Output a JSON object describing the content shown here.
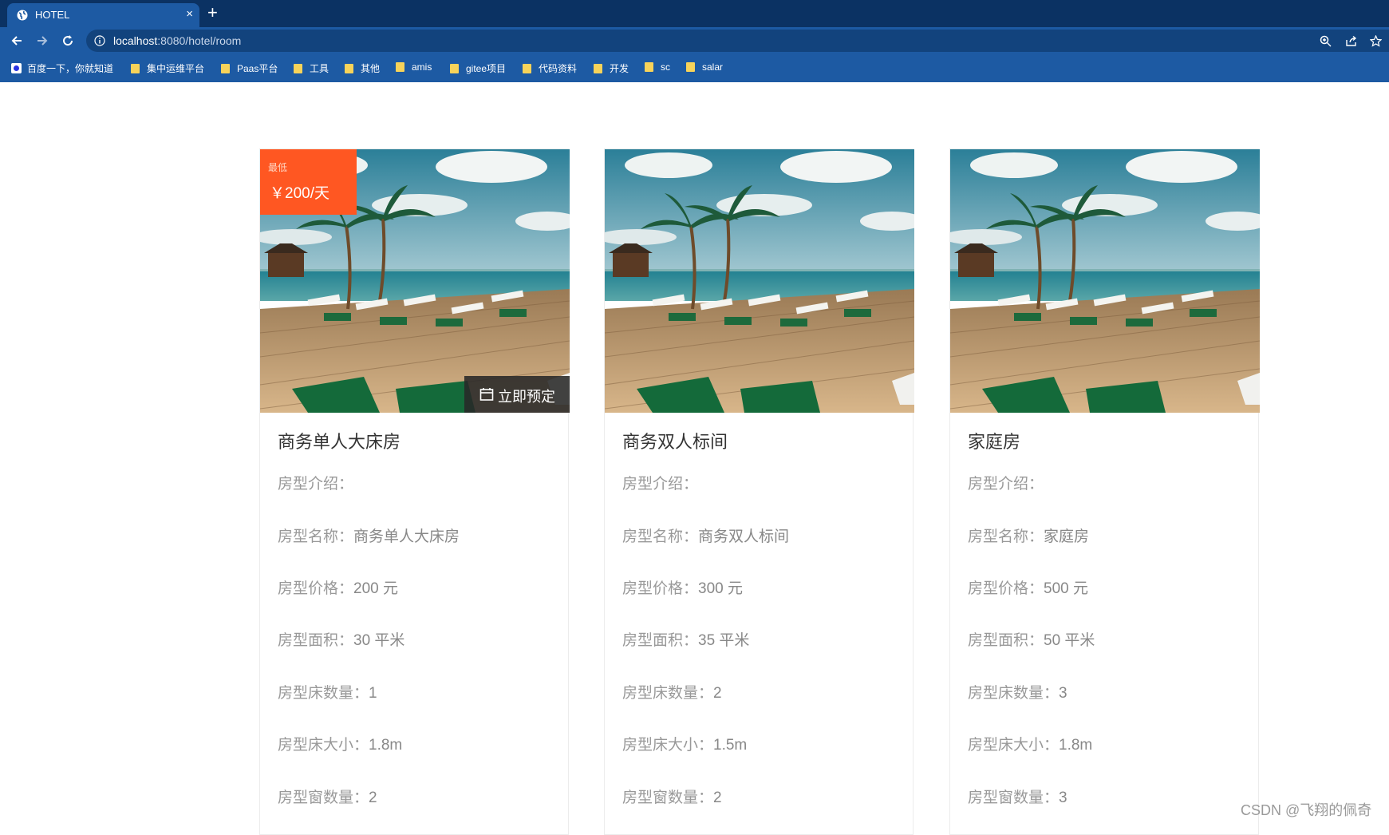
{
  "browser": {
    "tab_title": "HOTEL",
    "tab_close": "×",
    "new_tab": "+",
    "url_host": "localhost",
    "url_path": ":8080/hotel/room",
    "bookmarks": [
      "百度一下，你就知道",
      "集中运维平台",
      "Paas平台",
      "工具",
      "其他",
      "amis",
      "gitee项目",
      "代码资料",
      "开发",
      "sc",
      "salar"
    ],
    "colors": {
      "tabbar": "#0b3263",
      "toolbar": "#1d5aa3",
      "address_bar": "#12437d"
    }
  },
  "rooms": [
    {
      "title": "商务单人大床房",
      "badge_label": "最低",
      "badge_price": "￥200/天",
      "book_label": "立即预定",
      "fields": [
        {
          "label": "房型介绍：",
          "value": ""
        },
        {
          "label": "房型名称：",
          "value": "商务单人大床房"
        },
        {
          "label": "房型价格：",
          "value": "200 元"
        },
        {
          "label": "房型面积：",
          "value": "30 平米"
        },
        {
          "label": "房型床数量：",
          "value": "1"
        },
        {
          "label": "房型床大小：",
          "value": "1.8m"
        },
        {
          "label": "房型窗数量：",
          "value": "2"
        }
      ]
    },
    {
      "title": "商务双人标间",
      "fields": [
        {
          "label": "房型介绍：",
          "value": ""
        },
        {
          "label": "房型名称：",
          "value": "商务双人标间"
        },
        {
          "label": "房型价格：",
          "value": "300 元"
        },
        {
          "label": "房型面积：",
          "value": "35 平米"
        },
        {
          "label": "房型床数量：",
          "value": "2"
        },
        {
          "label": "房型床大小：",
          "value": "1.5m"
        },
        {
          "label": "房型窗数量：",
          "value": "2"
        }
      ]
    },
    {
      "title": "家庭房",
      "fields": [
        {
          "label": "房型介绍：",
          "value": ""
        },
        {
          "label": "房型名称：",
          "value": "家庭房"
        },
        {
          "label": "房型价格：",
          "value": "500 元"
        },
        {
          "label": "房型面积：",
          "value": "50 平米"
        },
        {
          "label": "房型床数量：",
          "value": "3"
        },
        {
          "label": "房型床大小：",
          "value": "1.8m"
        },
        {
          "label": "房型窗数量：",
          "value": "3"
        }
      ]
    }
  ],
  "colors": {
    "badge": "#ff5722",
    "book_button": "#2b2b2b"
  },
  "watermark": "CSDN @飞翔的佩奇"
}
